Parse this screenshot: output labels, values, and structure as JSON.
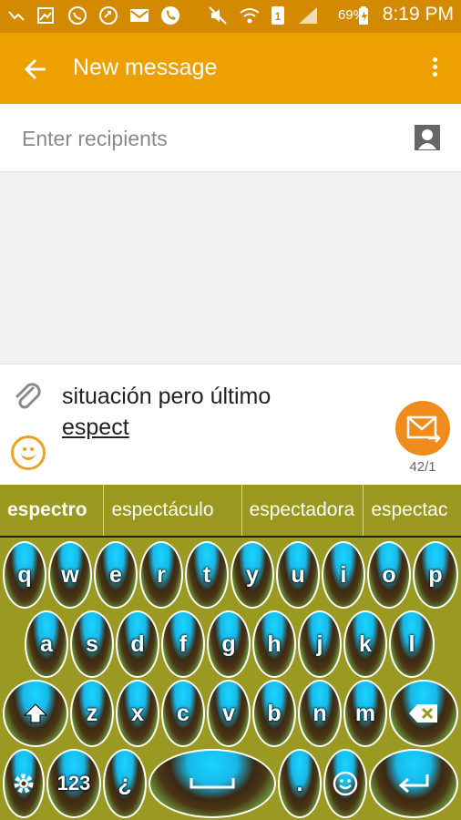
{
  "status_bar": {
    "left_icons": [
      "missed-call-icon",
      "gallery-icon",
      "whatsapp-icon",
      "sync-icon",
      "email-icon",
      "phone-icon"
    ],
    "right_icons": [
      "mute-icon",
      "wifi-icon",
      "sim-icon",
      "signal-icon"
    ],
    "battery": "69%",
    "time": "8:19 PM"
  },
  "app_bar": {
    "title": "New message"
  },
  "recipients": {
    "placeholder": "Enter recipients"
  },
  "compose": {
    "text_line1": "situación pero último",
    "text_composing": "espect",
    "counter": "42/1"
  },
  "suggestions": [
    "espectro",
    "espectáculo",
    "espectadora",
    "espectac"
  ],
  "keyboard": {
    "row1": [
      "q",
      "w",
      "e",
      "r",
      "t",
      "y",
      "u",
      "i",
      "o",
      "p"
    ],
    "row2": [
      "a",
      "s",
      "d",
      "f",
      "g",
      "h",
      "j",
      "k",
      "l"
    ],
    "row3": [
      "z",
      "x",
      "c",
      "v",
      "b",
      "n",
      "m"
    ],
    "row4": {
      "symbols": "123",
      "inverted_question": "¿",
      "period": "."
    }
  },
  "colors": {
    "status_bar": "#d48a00",
    "app_bar": "#eea000",
    "send_button": "#f08c1e",
    "keyboard_bg": "#9a9a22"
  }
}
